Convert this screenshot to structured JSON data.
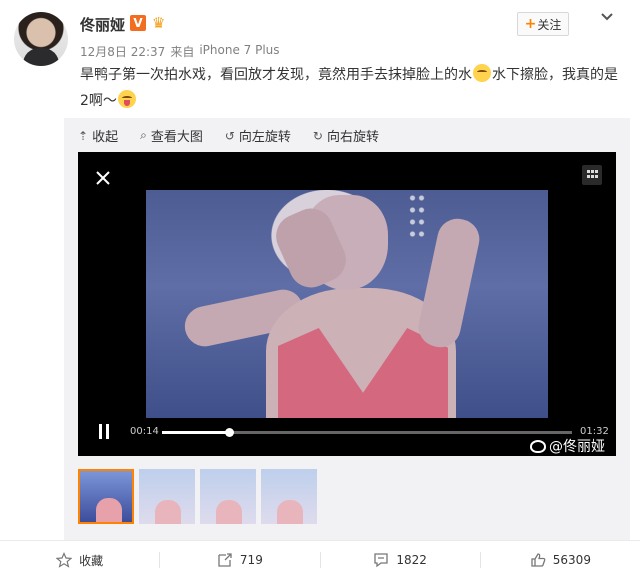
{
  "user": {
    "name": "佟丽娅",
    "vip_label": "V"
  },
  "header": {
    "follow_label": "关注"
  },
  "post": {
    "date": "12月8日 22:37",
    "source_prefix": "来自",
    "source_device": "iPhone 7 Plus",
    "text_part1": "旱鸭子第一次拍水戏，看回放才发现，竟然用手去抹掉脸上的水",
    "text_part2": "水下擦脸，我真的是2啊～"
  },
  "toolbar": {
    "collapse": "收起",
    "view_large": "查看大图",
    "rotate_left": "向左旋转",
    "rotate_right": "向右旋转"
  },
  "video": {
    "current_time": "00:14",
    "duration": "01:32",
    "progress": 0.163,
    "watermark": "@佟丽娅"
  },
  "thumbnails": {
    "count": 4,
    "active_index": 0
  },
  "actions": {
    "favorite": "收藏",
    "repost_count": "719",
    "comment_count": "1822",
    "like_count": "56309"
  },
  "colors": {
    "accent": "#ff8200",
    "vip": "#f26d1f",
    "progress_fill": "#ffffff"
  },
  "icons": [
    "close-icon",
    "grid-icon",
    "pause-icon",
    "star-icon",
    "repost-icon",
    "comment-icon",
    "like-icon"
  ]
}
